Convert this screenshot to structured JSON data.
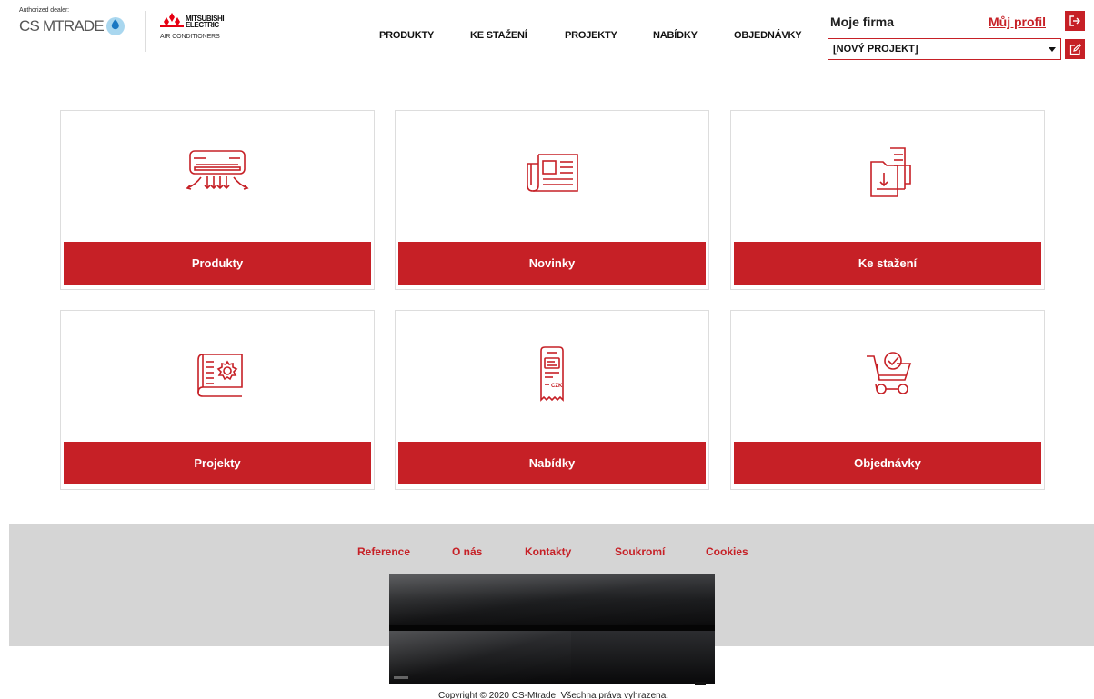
{
  "header": {
    "dealer_label": "Authorized dealer:",
    "dealer_name": "CS MTRADE",
    "brand_line1": "MITSUBISHI",
    "brand_line2": "ELECTRIC",
    "brand_sub": "AIR CONDITIONERS",
    "company": "Moje firma",
    "profile_link": "Můj profil",
    "project_select": "[NOVÝ PROJEKT]"
  },
  "nav": {
    "items": [
      "PRODUKTY",
      "KE STAŽENÍ",
      "PROJEKTY",
      "NABÍDKY",
      "OBJEDNÁVKY"
    ]
  },
  "tiles": [
    {
      "label": "Produkty",
      "icon": "air-conditioner-icon"
    },
    {
      "label": "Novinky",
      "icon": "newspaper-icon"
    },
    {
      "label": "Ke stažení",
      "icon": "download-document-icon"
    },
    {
      "label": "Projekty",
      "icon": "blueprint-gear-icon"
    },
    {
      "label": "Nabídky",
      "icon": "receipt-czk-icon"
    },
    {
      "label": "Objednávky",
      "icon": "cart-check-icon"
    }
  ],
  "receipt_currency": "CZK",
  "footer": {
    "links": [
      "Reference",
      "O nás",
      "Kontakty",
      "Soukromí",
      "Cookies"
    ],
    "copyright": "Copyright © 2020 CS-Mtrade. Všechna práva vyhrazena."
  },
  "colors": {
    "accent": "#c62026",
    "footer_bg": "#d5d5d5",
    "tile_border": "#dddddd"
  }
}
